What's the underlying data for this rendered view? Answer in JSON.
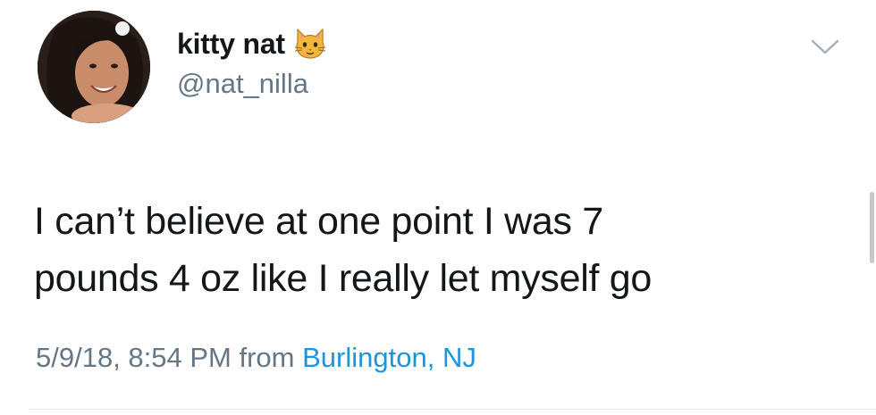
{
  "tweet": {
    "display_name": "kitty nat",
    "name_emoji": "cat-face-emoji",
    "handle": "@nat_nilla",
    "text_line1": "I can’t believe at one point I was 7",
    "text_line2": "pounds 4 oz like I really let myself go",
    "timestamp": "5/9/18, 8:54 PM",
    "from_label": "from",
    "location": "Burlington, NJ"
  },
  "colors": {
    "text": "#14171a",
    "secondary": "#657786",
    "link": "#1b95e0",
    "divider": "#e1e8ed"
  },
  "icons": {
    "menu": "chevron-down-icon"
  }
}
